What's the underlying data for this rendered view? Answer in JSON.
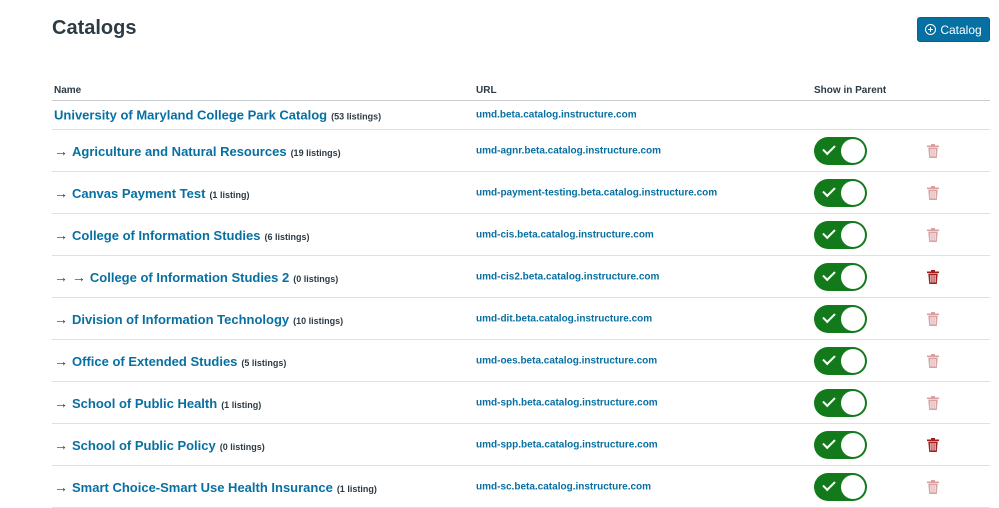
{
  "page": {
    "title": "Catalogs",
    "add_button_label": "Catalog"
  },
  "columns": {
    "name": "Name",
    "url": "URL",
    "show_in_parent": "Show in Parent"
  },
  "colors": {
    "link": "#0770a3",
    "toggle_on": "#127a1b",
    "trash_light": "#d8a0a0",
    "trash_dark": "#a21f1f",
    "button": "#0770a3"
  },
  "parent": {
    "name": "University of Maryland College Park Catalog",
    "count": "(53 listings)",
    "url": "umd.beta.catalog.instructure.com"
  },
  "rows": [
    {
      "arrows": "→",
      "name": "Agriculture and Natural Resources",
      "count": "(19 listings)",
      "url": "umd-agnr.beta.catalog.instructure.com",
      "show_in_parent": true,
      "trash_icon": "trash-icon-light"
    },
    {
      "arrows": "→",
      "name": "Canvas Payment Test",
      "count": "(1 listing)",
      "url": "umd-payment-testing.beta.catalog.instructure.com",
      "show_in_parent": true,
      "trash_icon": "trash-icon-light"
    },
    {
      "arrows": "→",
      "name": "College of Information Studies",
      "count": "(6 listings)",
      "url": "umd-cis.beta.catalog.instructure.com",
      "show_in_parent": true,
      "trash_icon": "trash-icon-light"
    },
    {
      "arrows": "→ →",
      "name": "College of Information Studies 2",
      "count": "(0 listings)",
      "url": "umd-cis2.beta.catalog.instructure.com",
      "show_in_parent": true,
      "trash_icon": "trash-icon-dark"
    },
    {
      "arrows": "→",
      "name": "Division of Information Technology",
      "count": "(10 listings)",
      "url": "umd-dit.beta.catalog.instructure.com",
      "show_in_parent": true,
      "trash_icon": "trash-icon-light"
    },
    {
      "arrows": "→",
      "name": "Office of Extended Studies",
      "count": "(5 listings)",
      "url": "umd-oes.beta.catalog.instructure.com",
      "show_in_parent": true,
      "trash_icon": "trash-icon-light"
    },
    {
      "arrows": "→",
      "name": "School of Public Health",
      "count": "(1 listing)",
      "url": "umd-sph.beta.catalog.instructure.com",
      "show_in_parent": true,
      "trash_icon": "trash-icon-light"
    },
    {
      "arrows": "→",
      "name": "School of Public Policy",
      "count": "(0 listings)",
      "url": "umd-spp.beta.catalog.instructure.com",
      "show_in_parent": true,
      "trash_icon": "trash-icon-dark"
    },
    {
      "arrows": "→",
      "name": "Smart Choice-Smart Use Health Insurance",
      "count": "(1 listing)",
      "url": "umd-sc.beta.catalog.instructure.com",
      "show_in_parent": true,
      "trash_icon": "trash-icon-light"
    }
  ]
}
